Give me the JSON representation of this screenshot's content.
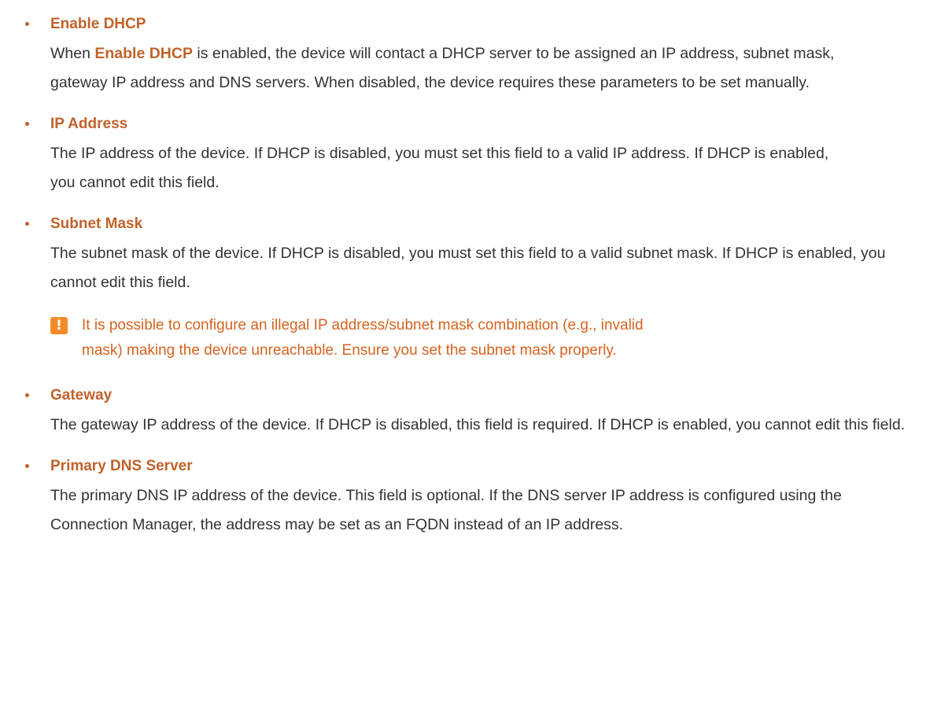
{
  "items": [
    {
      "term": "Enable DHCP",
      "desc_prefix": "When ",
      "desc_highlight": "Enable DHCP",
      "desc_suffix": " is enabled, the device will contact a DHCP server to be assigned an IP address, subnet mask, gateway IP address and DNS servers. When disabled, the device requires these parameters to be set manually."
    },
    {
      "term": "IP Address",
      "desc": "The IP address of the device. If DHCP is disabled, you must set this field to a valid IP address. If DHCP is enabled, you cannot edit this field."
    },
    {
      "term": "Subnet Mask",
      "desc": "The subnet mask of the device. If DHCP is disabled, you must set this field to a valid subnet mask. If DHCP is enabled, you cannot edit this field."
    },
    {
      "term": "Gateway",
      "desc": "The gateway IP address of the device. If DHCP is disabled, this field is required. If DHCP is enabled, you cannot edit this field."
    },
    {
      "term": "Primary DNS Server",
      "desc": "The primary DNS IP address of the device. This field is optional. If the DNS server IP address is configured using the Connection Manager, the address may be set as an FQDN instead of an IP address."
    }
  ],
  "note": {
    "icon": "!",
    "text": "It is possible to configure an illegal IP address/subnet mask combination (e.g., invalid mask) making the device unreachable. Ensure you set the subnet mask properly."
  },
  "colors": {
    "accent": "#c0622a",
    "note_text": "#d4631f",
    "note_icon": "#f48b2b",
    "body_text": "#333333"
  }
}
